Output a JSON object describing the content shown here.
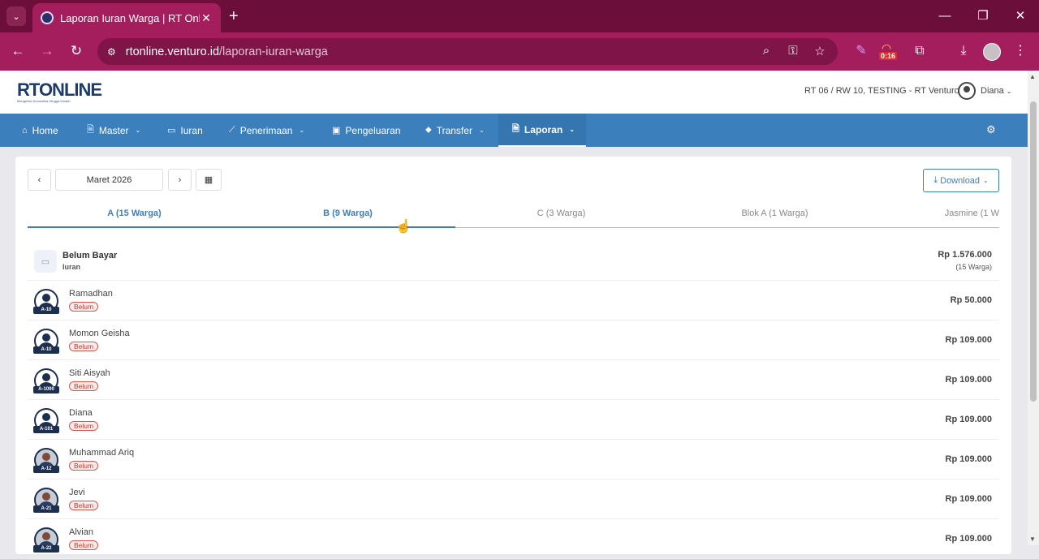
{
  "browser": {
    "tab_title": "Laporan Iuran Warga | RT Online",
    "site_info": "⚙",
    "url_domain": "rtonline.venturo.id",
    "url_path": "/laporan-iuran-warga",
    "timer": "0:16",
    "accent": "#a41d5d"
  },
  "app": {
    "logo_main": "RT",
    "logo_rest": "ONLINE",
    "logo_tagline": "Mengelola Komunitas Hingga Mudah",
    "rt_info": "RT 06 / RW 10, TESTING - RT Venturo",
    "user_name": "Diana",
    "primary_color": "#3c7fbd"
  },
  "menu": {
    "home": "Home",
    "master": "Master",
    "iuran": "Iuran",
    "penerimaan": "Penerimaan",
    "pengeluaran": "Pengeluaran",
    "transfer": "Transfer",
    "laporan": "Laporan"
  },
  "toolbar": {
    "prev": "‹",
    "month": "Maret 2026",
    "next": "›",
    "download": "Download"
  },
  "tabs": [
    {
      "label": "A (15 Warga)"
    },
    {
      "label": "B (9 Warga)"
    },
    {
      "label": "C (3 Warga)"
    },
    {
      "label": "Blok A (1 Warga)"
    },
    {
      "label": "Jasmine (1 W"
    }
  ],
  "summary": {
    "title": "Belum Bayar",
    "subtitle": "Iuran",
    "amount": "Rp 1.576.000",
    "count": "(15 Warga)"
  },
  "residents": [
    {
      "name": "Ramadhan",
      "unit": "A-10",
      "status": "Belum",
      "amount": "Rp 50.000"
    },
    {
      "name": "Momon Geisha",
      "unit": "A-10",
      "status": "Belum",
      "amount": "Rp 109.000"
    },
    {
      "name": "Siti Aisyah",
      "unit": "A-1000",
      "status": "Belum",
      "amount": "Rp 109.000"
    },
    {
      "name": "Diana",
      "unit": "A-101",
      "status": "Belum",
      "amount": "Rp 109.000"
    },
    {
      "name": "Muhammad Ariq",
      "unit": "A-12",
      "status": "Belum",
      "amount": "Rp 109.000"
    },
    {
      "name": "Jevi",
      "unit": "A-21",
      "status": "Belum",
      "amount": "Rp 109.000"
    },
    {
      "name": "Alvian",
      "unit": "A-22",
      "status": "Belum",
      "amount": "Rp 109.000"
    }
  ]
}
